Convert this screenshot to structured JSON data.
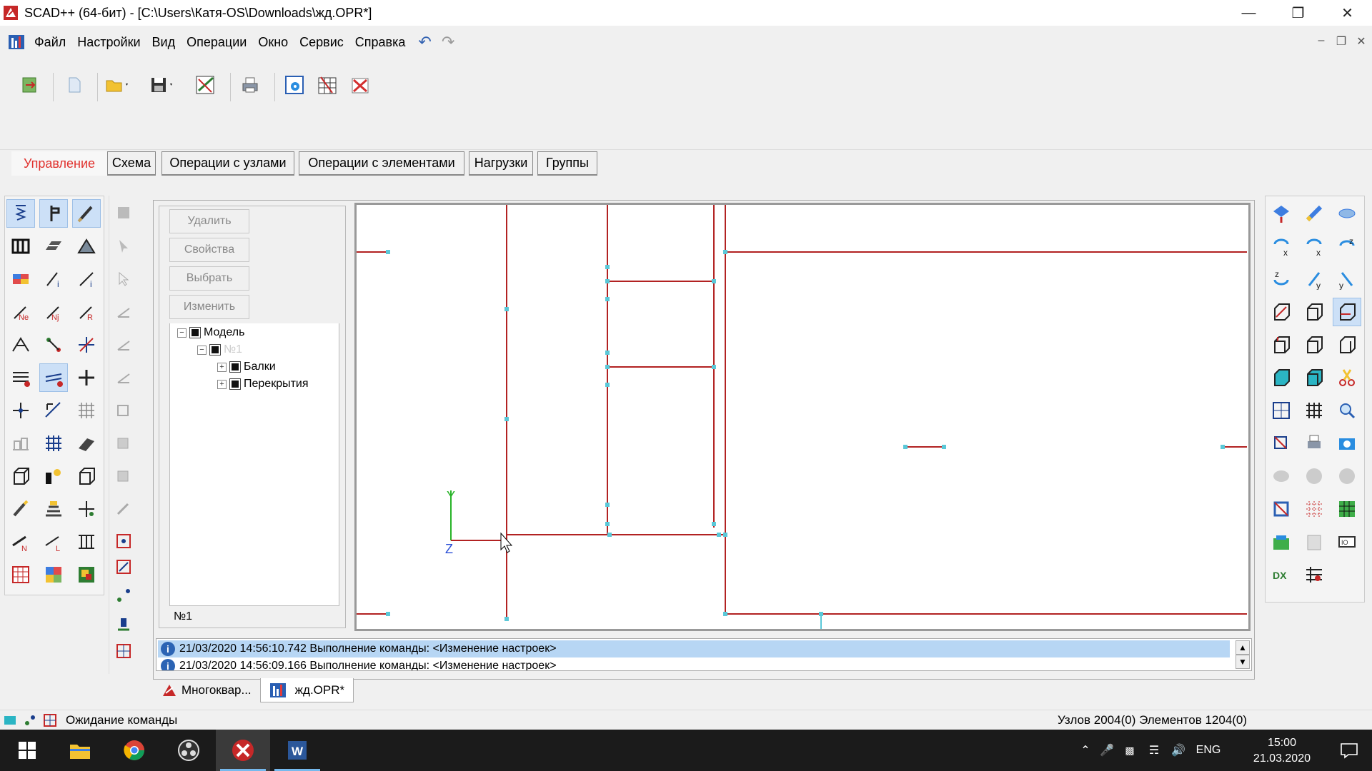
{
  "window": {
    "title": "SCAD++ (64-бит) - [C:\\Users\\Катя-OS\\Downloads\\жд.OPR*]",
    "controls": [
      "minimize-icon",
      "restore-icon",
      "close-icon"
    ]
  },
  "menu": {
    "items": [
      "Файл",
      "Настройки",
      "Вид",
      "Операции",
      "Окно",
      "Сервис",
      "Справка"
    ]
  },
  "tabs": {
    "items": [
      "Управление",
      "Схема",
      "Операции с узлами",
      "Операции с элементами",
      "Нагрузки",
      "Группы"
    ],
    "active": "Управление"
  },
  "side_buttons": [
    "Удалить",
    "Свойства",
    "Выбрать",
    "Изменить"
  ],
  "tree": {
    "root": "Модель",
    "group": "№1",
    "children": [
      "Балки",
      "Перекрытия"
    ],
    "footer": "№1"
  },
  "canvas": {
    "axis_y": "Y",
    "axis_z": "Z",
    "colors": {
      "member": "#b22222",
      "node": "#5bc8d8",
      "axis_y": "#27b327",
      "axis_z": "#2a4fd6"
    }
  },
  "log": {
    "rows": [
      {
        "date": "21/03/2020",
        "time": "14:56:10.742",
        "text": "Выполнение команды: <Изменение настроек>"
      },
      {
        "date": "21/03/2020",
        "time": "14:56:09.166",
        "text": "Выполнение команды: <Изменение настроек>"
      }
    ]
  },
  "doc_tabs": [
    "Многоквар...",
    "жд.OPR*"
  ],
  "status": {
    "message": "Ожидание команды",
    "counts": "Узлов 2004(0) Элементов 1204(0)"
  },
  "taskbar": {
    "language": "ENG",
    "time": "15:00",
    "date": "21.03.2020"
  }
}
